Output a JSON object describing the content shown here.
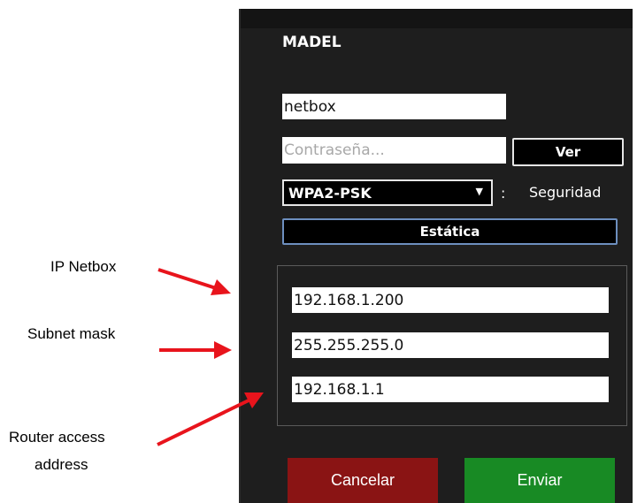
{
  "annotations": {
    "ip_netbox": "IP Netbox",
    "subnet_mask": "Subnet mask",
    "router_line1": "Router access",
    "router_line2": "address"
  },
  "dialog": {
    "title": "MADEL",
    "network_name": "netbox",
    "password_placeholder": "Contraseña...",
    "show_label": "Ver",
    "security_value": "WPA2-PSK",
    "security_separator": ":",
    "security_label": "Seguridad",
    "static_label": "Estática",
    "ip_address": "192.168.1.200",
    "subnet_mask": "255.255.255.0",
    "gateway": "192.168.1.1",
    "cancel_label": "Cancelar",
    "send_label": "Enviar"
  },
  "colors": {
    "panel_bg": "#1e1e1e",
    "cancel_bg": "#8a1414",
    "send_bg": "#188a24",
    "arrow": "#e8141c",
    "static_border": "#6d8fbf"
  },
  "icons": {
    "dropdown": "triangle-down"
  }
}
